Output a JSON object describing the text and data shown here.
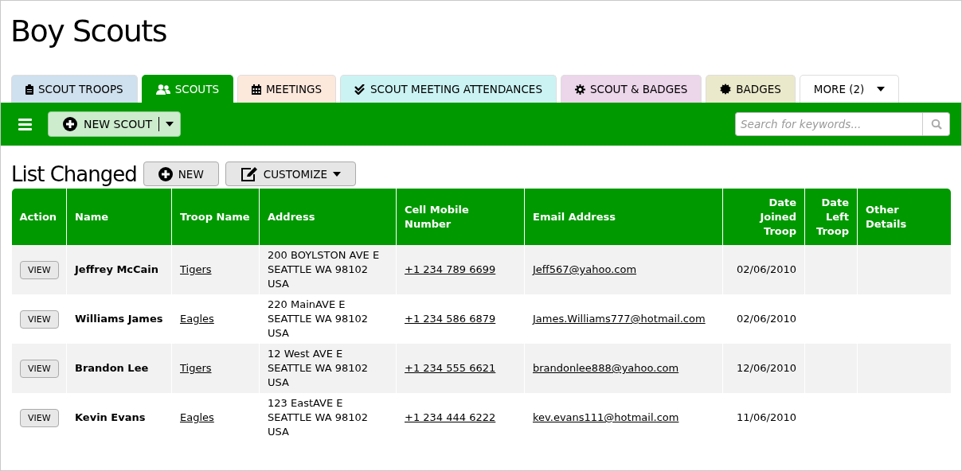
{
  "page_title": "Boy Scouts",
  "tabs": [
    {
      "label": "SCOUT TROOPS",
      "kind": "clipboard",
      "color": "#cfe0ee",
      "selected": false
    },
    {
      "label": "SCOUTS",
      "kind": "users",
      "color": "#009900",
      "selected": true
    },
    {
      "label": "MEETINGS",
      "kind": "calendar",
      "color": "#fde8dc",
      "selected": false
    },
    {
      "label": "SCOUT MEETING ATTENDANCES",
      "kind": "check",
      "color": "#ccf3f3",
      "selected": false
    },
    {
      "label": "SCOUT & BADGES",
      "kind": "gear",
      "color": "#ecd6ea",
      "selected": false
    },
    {
      "label": "BADGES",
      "kind": "badge",
      "color": "#ebe9cb",
      "selected": false
    },
    {
      "label": "MORE (2)",
      "kind": "dropdown",
      "color": "#ffffff",
      "selected": false
    }
  ],
  "toolbar": {
    "new_button": "NEW SCOUT",
    "search": {
      "placeholder": "Search for keywords..."
    }
  },
  "list": {
    "title": "List Changed",
    "new_button": "NEW",
    "customize_button": "CUSTOMIZE"
  },
  "table": {
    "columns": [
      {
        "label": "Action",
        "kind": "text"
      },
      {
        "label": "Name",
        "kind": "text"
      },
      {
        "label": "Troop Name",
        "kind": "text"
      },
      {
        "label": "Address",
        "kind": "text"
      },
      {
        "label": "Cell Mobile Number",
        "kind": "text"
      },
      {
        "label": "Email Address",
        "kind": "text"
      },
      {
        "label": "Date Joined Troop",
        "kind": "date"
      },
      {
        "label": "Date Left Troop",
        "kind": "date"
      },
      {
        "label": "Other Details",
        "kind": "text"
      }
    ],
    "rows": [
      {
        "action": "VIEW",
        "name": "Jeffrey McCain",
        "troop": "Tigers",
        "address": [
          "200 BOYLSTON AVE E",
          "SEATTLE WA 98102",
          "USA"
        ],
        "phone": "+1 234 789 6699",
        "email": "Jeff567@yahoo.com",
        "joined": "02/06/2010"
      },
      {
        "action": "VIEW",
        "name": "Williams James",
        "troop": "Eagles",
        "address": [
          "220 MainAVE E",
          "SEATTLE WA 98102",
          "USA"
        ],
        "phone": "+1 234 586 6879",
        "email": "James.Williams777@hotmail.com",
        "joined": "02/06/2010"
      },
      {
        "action": "VIEW",
        "name": "Brandon Lee",
        "troop": "Tigers",
        "address": [
          "12 West AVE E",
          "SEATTLE WA 98102",
          "USA"
        ],
        "phone": "+1 234 555 6621",
        "email": "brandonlee888@yahoo.com",
        "joined": "12/06/2010"
      },
      {
        "action": "VIEW",
        "name": "Kevin Evans",
        "troop": "Eagles",
        "address": [
          "123 EastAVE E",
          "SEATTLE WA 98102",
          "USA"
        ],
        "phone": "+1 234 444 6222",
        "email": "kev.evans111@hotmail.com",
        "joined": "11/06/2010"
      }
    ]
  }
}
